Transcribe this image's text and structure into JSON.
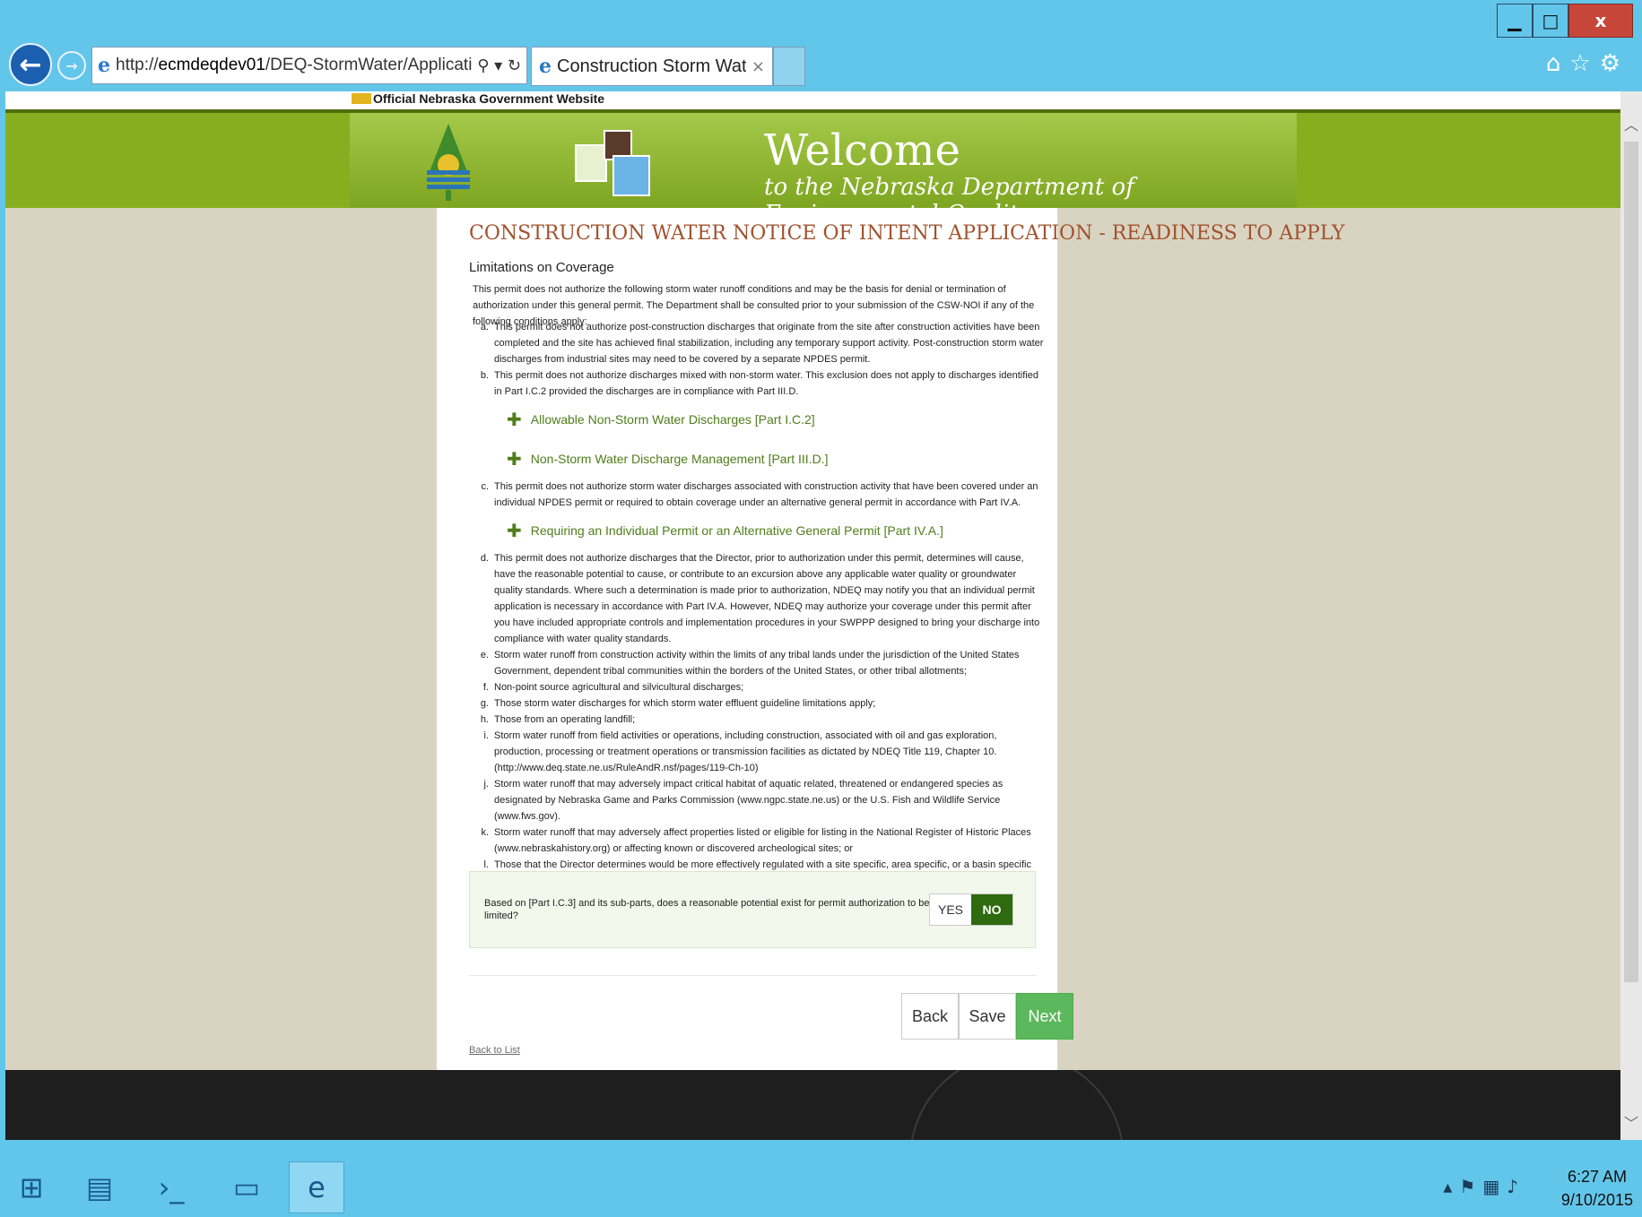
{
  "browser": {
    "url_prefix": "http://",
    "url_host": "ecmdeqdev01",
    "url_path": "/DEQ-StormWater/Application/I",
    "tab_title": "Construction Storm Water ...",
    "tab_close": "×"
  },
  "site": {
    "gov_text": "Official Nebraska Government Website",
    "welcome": "Welcome",
    "welcome_sub": "to the Nebraska Department of Environmental Quality"
  },
  "page": {
    "heading": "CONSTRUCTION WATER NOTICE OF INTENT APPLICATION - READINESS TO APPLY",
    "section_title": "Limitations on Coverage",
    "intro": "This permit does not authorize the following storm water runoff conditions and may be the basis for denial or termination of authorization under this general permit. The Department shall be consulted prior to your submission of the CSW-NOI if any of the following conditions apply:",
    "items": [
      {
        "label": "a.",
        "text": "This permit does not authorize post-construction discharges that originate from the site after construction activities have been completed and the site has achieved final stabilization, including any temporary support activity. Post-construction storm water discharges from industrial sites may need to be covered by a separate NPDES permit."
      },
      {
        "label": "b.",
        "text": "This permit does not authorize discharges mixed with non-storm water. This exclusion does not apply to discharges identified in Part I.C.2 provided the discharges are in compliance with Part III.D."
      },
      {
        "label": "c.",
        "text": "This permit does not authorize storm water discharges associated with construction activity that have been covered under an individual NPDES permit or required to obtain coverage under an alternative general permit in accordance with Part IV.A."
      },
      {
        "label": "d.",
        "text": "This permit does not authorize discharges that the Director, prior to authorization under this permit, determines will cause, have the reasonable potential to cause, or contribute to an excursion above any applicable water quality or groundwater quality standards. Where such a determination is made prior to authorization, NDEQ may notify you that an individual permit application is necessary in accordance with Part IV.A. However, NDEQ may authorize your coverage under this permit after you have included appropriate controls and implementation procedures in your SWPPP designed to bring your discharge into compliance with water quality standards."
      },
      {
        "label": "e.",
        "text": "Storm water runoff from construction activity within the limits of any tribal lands under the jurisdiction of the United States Government, dependent tribal communities within the borders of the United States, or other tribal allotments;"
      },
      {
        "label": "f.",
        "text": "Non-point source agricultural and silvicultural discharges;"
      },
      {
        "label": "g.",
        "text": "Those storm water discharges for which storm water effluent guideline limitations apply;"
      },
      {
        "label": "h.",
        "text": "Those from an operating landfill;"
      },
      {
        "label": "i.",
        "text": "Storm water runoff from field activities or operations, including construction, associated with oil and gas exploration, production, processing or treatment operations or transmission facilities as dictated by NDEQ Title 119, Chapter 10. (http://www.deq.state.ne.us/RuleAndR.nsf/pages/119-Ch-10)"
      },
      {
        "label": "j.",
        "text": "Storm water runoff that may adversely impact critical habitat of aquatic related, threatened or endangered species as designated by Nebraska Game and Parks Commission (www.ngpc.state.ne.us) or the U.S. Fish and Wildlife Service (www.fws.gov)."
      },
      {
        "label": "k.",
        "text": "Storm water runoff that may adversely affect properties listed or eligible for listing in the National Register of Historic Places (www.nebraskahistory.org) or affecting known or discovered archeological sites; or"
      },
      {
        "label": "l.",
        "text": "Those that the Director determines would be more effectively regulated with a site specific, area specific, or a basin specific permit."
      }
    ],
    "expanders": [
      "Allowable Non-Storm Water Discharges [Part I.C.2]",
      "Non-Storm Water Discharge Management [Part III.D.]",
      "Requiring an Individual Permit or an Alternative General Permit [Part IV.A.]"
    ],
    "question": "Based on [Part I.C.3] and its sub-parts, does a reasonable potential exist for permit authorization to be limited?",
    "toggle_yes": "YES",
    "toggle_no": "NO",
    "toggle_selected": "NO",
    "btn_back": "Back",
    "btn_save": "Save",
    "btn_next": "Next",
    "back_to_list": "Back to List"
  },
  "taskbar": {
    "time": "6:27 AM",
    "date": "9/10/2015"
  },
  "colors": {
    "heading": "#a0522d",
    "accent_green": "#4f7d1a",
    "toggle_selected": "#2f6a0f",
    "next_button": "#5cb85c"
  }
}
